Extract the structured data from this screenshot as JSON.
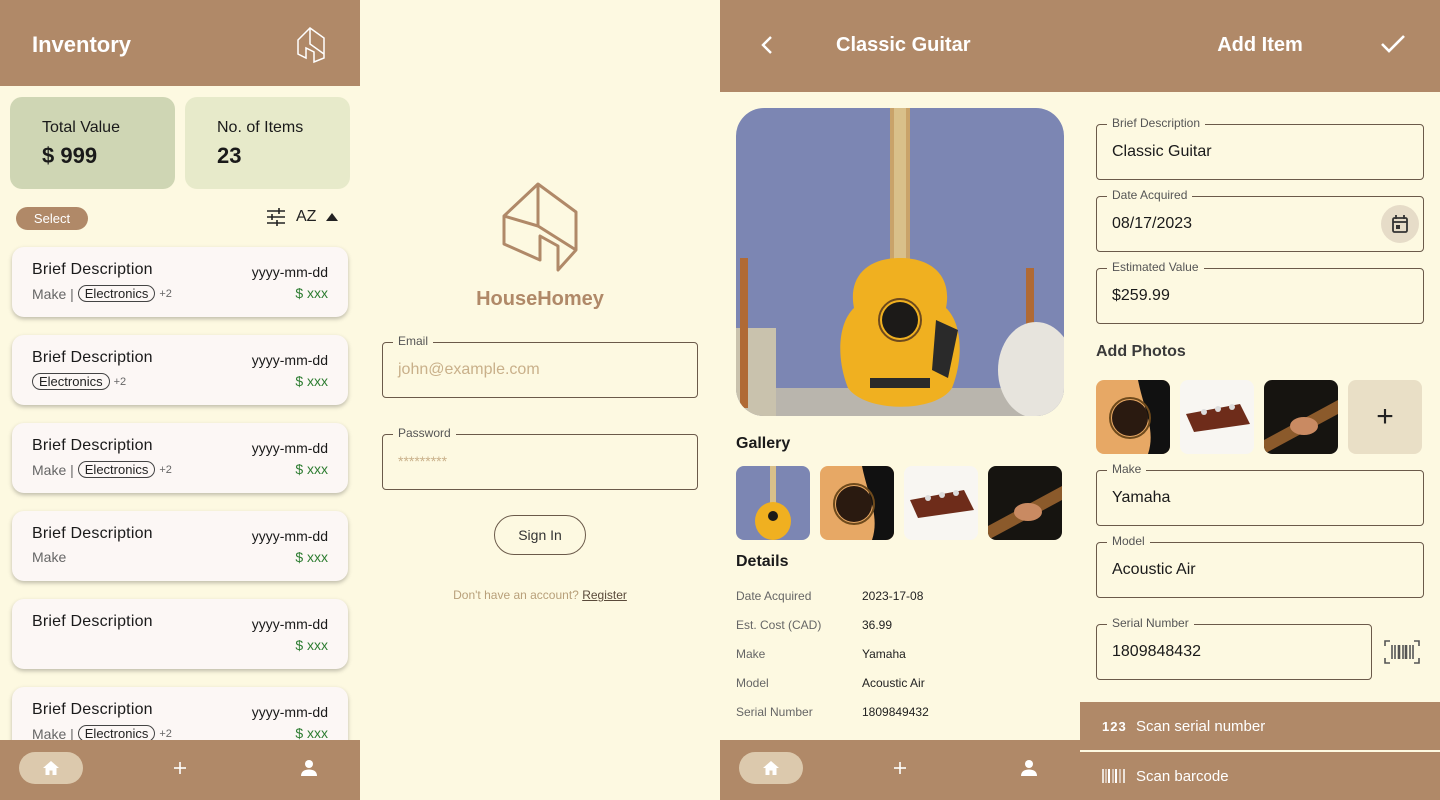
{
  "inventory": {
    "title": "Inventory",
    "stats": [
      {
        "label": "Total Value",
        "value": "$ 999"
      },
      {
        "label": "No. of Items",
        "value": "23"
      }
    ],
    "select_label": "Select",
    "sort_label": "AZ",
    "items": [
      {
        "title": "Brief Description",
        "make": "Make |",
        "tag": "Electronics",
        "more": "+2",
        "date": "yyyy-mm-dd",
        "price": "$ xxx"
      },
      {
        "title": "Brief Description",
        "make": "",
        "tag": "Electronics",
        "more": "+2",
        "date": "yyyy-mm-dd",
        "price": "$ xxx"
      },
      {
        "title": "Brief Description",
        "make": "Make |",
        "tag": "Electronics",
        "more": "+2",
        "date": "yyyy-mm-dd",
        "price": "$ xxx"
      },
      {
        "title": "Brief Description",
        "make": "Make",
        "tag": "",
        "more": "",
        "date": "yyyy-mm-dd",
        "price": "$ xxx"
      },
      {
        "title": "Brief Description",
        "make": "",
        "tag": "",
        "more": "",
        "date": "yyyy-mm-dd",
        "price": "$ xxx"
      },
      {
        "title": "Brief Description",
        "make": "Make |",
        "tag": "Electronics",
        "more": "+2",
        "date": "yyyy-mm-dd",
        "price": "$ xxx"
      }
    ]
  },
  "login": {
    "brand": "HouseHomey",
    "email_label": "Email",
    "email_placeholder": "john@example.com",
    "password_label": "Password",
    "password_placeholder": "*********",
    "signin_label": "Sign In",
    "register_prompt": "Don't have an account?",
    "register_link": "Register"
  },
  "detail": {
    "title": "Classic Guitar",
    "gallery_title": "Gallery",
    "details_title": "Details",
    "rows": [
      {
        "label": "Date Acquired",
        "value": "2023-17-08"
      },
      {
        "label": "Est. Cost (CAD)",
        "value": "36.99"
      },
      {
        "label": "Make",
        "value": "Yamaha"
      },
      {
        "label": "Model",
        "value": "Acoustic Air"
      },
      {
        "label": "Serial Number",
        "value": "1809849432"
      }
    ]
  },
  "add_item": {
    "title": "Add Item",
    "fields": {
      "description": {
        "label": "Brief Description",
        "value": "Classic Guitar"
      },
      "date": {
        "label": "Date Acquired",
        "value": "08/17/2023"
      },
      "value": {
        "label": "Estimated Value",
        "value": "$259.99"
      },
      "make": {
        "label": "Make",
        "value": "Yamaha"
      },
      "model": {
        "label": "Model",
        "value": "Acoustic Air"
      },
      "serial": {
        "label": "Serial Number",
        "value": "1809848432"
      }
    },
    "photos_title": "Add Photos",
    "add_photo_glyph": "+",
    "sheet": {
      "scan_serial": "Scan serial number",
      "scan_barcode": "Scan barcode",
      "serial_icon_text": "123"
    }
  },
  "colors": {
    "accent": "#b08968",
    "background": "#fdf9e1",
    "price_green": "#2e7d32"
  }
}
